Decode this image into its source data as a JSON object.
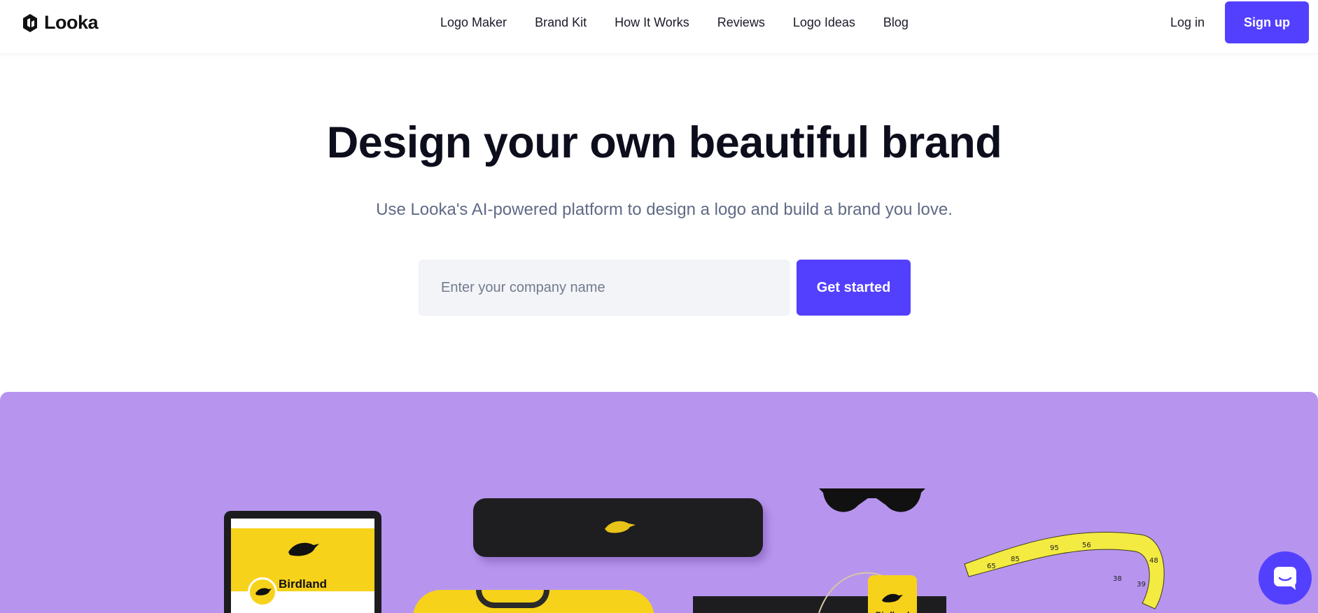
{
  "brand": {
    "name": "Looka",
    "accent": "#5340ff"
  },
  "nav": {
    "items": [
      {
        "label": "Logo Maker"
      },
      {
        "label": "Brand Kit"
      },
      {
        "label": "How It Works"
      },
      {
        "label": "Reviews"
      },
      {
        "label": "Logo Ideas"
      },
      {
        "label": "Blog"
      }
    ],
    "login_label": "Log in",
    "signup_label": "Sign up"
  },
  "hero": {
    "title": "Design your own beautiful brand",
    "subtitle": "Use Looka's AI-powered platform to design a logo and build a brand you love.",
    "input_placeholder": "Enter your company name",
    "cta_label": "Get started"
  },
  "showcase": {
    "background_color": "#b795ee",
    "sample_brand": "Birdland",
    "brand_color": "#f7d21b",
    "tape_marks": [
      "65",
      "85",
      "95",
      "56",
      "38",
      "39",
      "48"
    ]
  },
  "chat": {
    "icon": "chat-icon"
  }
}
